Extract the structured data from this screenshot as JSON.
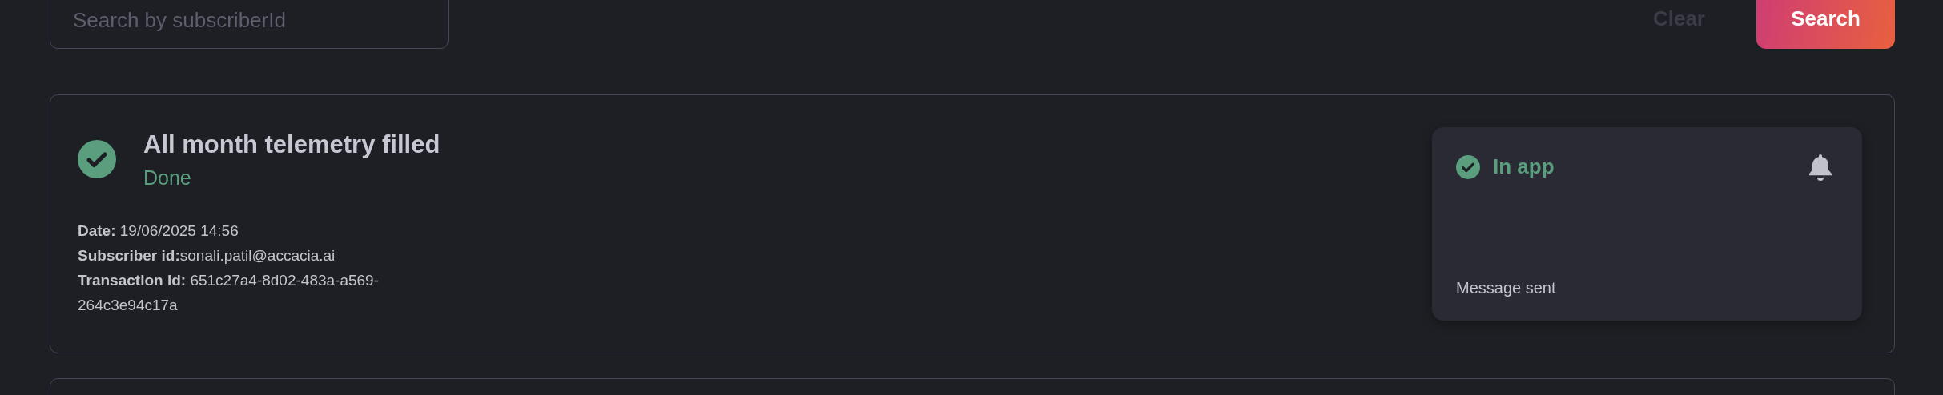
{
  "search": {
    "placeholder": "Search by subscriberId"
  },
  "buttons": [
    {
      "kind": "clear",
      "label": "Clear",
      "disabled": true
    },
    {
      "kind": "search",
      "label": "Search",
      "disabled": false
    }
  ],
  "notifications": [
    {
      "title": "All month telemetry filled",
      "done": true,
      "status_label": "Done",
      "details": [
        {
          "label": "Date:",
          "value": " 19/06/2025 14:56"
        },
        {
          "label": "Subscriber id:",
          "value": "sonali.patil@accacia.ai"
        },
        {
          "label": "Transaction id:",
          "value": " 651c27a4-8d02-483a-a569-264c3e94c17a"
        }
      ],
      "channels": [
        {
          "name": "In app",
          "done": true,
          "message": "Message sent"
        }
      ]
    }
  ]
}
